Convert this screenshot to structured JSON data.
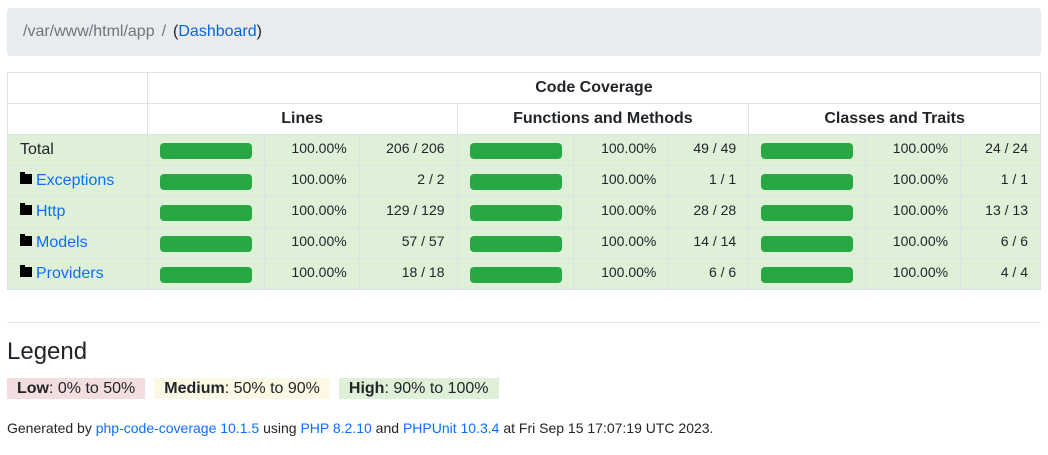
{
  "breadcrumb": {
    "path": "/var/www/html/app",
    "separator": "/",
    "link_label": "Dashboard",
    "open_paren": "(",
    "close_paren": ")"
  },
  "table": {
    "header_main": "Code Coverage",
    "header_lines": "Lines",
    "header_functions": "Functions and Methods",
    "header_classes": "Classes and Traits",
    "rows": [
      {
        "name": "Total",
        "is_link": false,
        "lines_pct": "100.00%",
        "lines_count": "206 / 206",
        "lines_fill": 1.0,
        "fn_pct": "100.00%",
        "fn_count": "49 / 49",
        "fn_fill": 1.0,
        "cls_pct": "100.00%",
        "cls_count": "24 / 24",
        "cls_fill": 1.0
      },
      {
        "name": "Exceptions",
        "is_link": true,
        "icon": "folder-icon",
        "lines_pct": "100.00%",
        "lines_count": "2 / 2",
        "lines_fill": 1.0,
        "fn_pct": "100.00%",
        "fn_count": "1 / 1",
        "fn_fill": 1.0,
        "cls_pct": "100.00%",
        "cls_count": "1 / 1",
        "cls_fill": 1.0
      },
      {
        "name": "Http",
        "is_link": true,
        "icon": "folder-icon",
        "lines_pct": "100.00%",
        "lines_count": "129 / 129",
        "lines_fill": 1.0,
        "fn_pct": "100.00%",
        "fn_count": "28 / 28",
        "fn_fill": 1.0,
        "cls_pct": "100.00%",
        "cls_count": "13 / 13",
        "cls_fill": 1.0
      },
      {
        "name": "Models",
        "is_link": true,
        "icon": "folder-icon",
        "lines_pct": "100.00%",
        "lines_count": "57 / 57",
        "lines_fill": 1.0,
        "fn_pct": "100.00%",
        "fn_count": "14 / 14",
        "fn_fill": 1.0,
        "cls_pct": "100.00%",
        "cls_count": "6 / 6",
        "cls_fill": 1.0
      },
      {
        "name": "Providers",
        "is_link": true,
        "icon": "folder-icon",
        "lines_pct": "100.00%",
        "lines_count": "18 / 18",
        "lines_fill": 1.0,
        "fn_pct": "100.00%",
        "fn_count": "6 / 6",
        "fn_fill": 1.0,
        "cls_pct": "100.00%",
        "cls_count": "4 / 4",
        "cls_fill": 1.0
      }
    ]
  },
  "legend": {
    "title": "Legend",
    "low_label": "Low",
    "low_range": ": 0% to 50%",
    "medium_label": "Medium",
    "medium_range": ": 50% to 90%",
    "high_label": "High",
    "high_range": ": 90% to 100%"
  },
  "footer": {
    "t1": "Generated by ",
    "tool_link": "php-code-coverage 10.1.5",
    "t2": " using ",
    "php_link": "PHP 8.2.10",
    "t3": " and ",
    "phpunit_link": "PHPUnit 10.3.4",
    "t4": " at Fri Sep 15 17:07:19 UTC 2023."
  },
  "colors": {
    "bar_success": "#28a745",
    "row_success_bg": "#dff0d8",
    "low_bg": "#f2dede",
    "medium_bg": "#fcf8e3",
    "high_bg": "#dff0d8",
    "link": "#0d6efd"
  }
}
